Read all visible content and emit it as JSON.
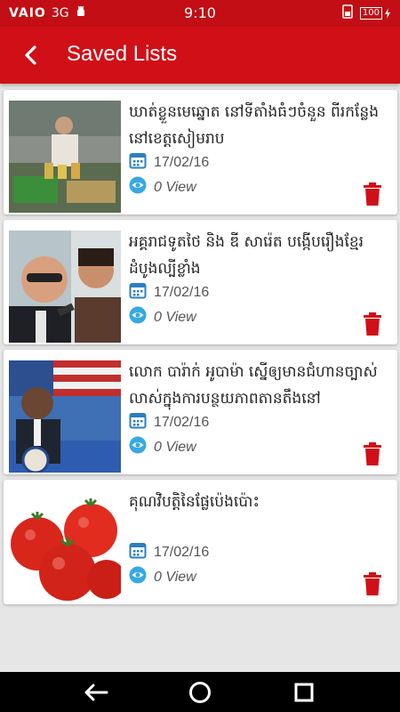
{
  "status_bar": {
    "brand": "VAIO",
    "network": "3G",
    "time": "9:10",
    "battery": "100"
  },
  "app_bar": {
    "title": "Saved Lists"
  },
  "items": [
    {
      "headline": "ឃាត់ខ្លួនមេឆ្នោត នៅទីតាំងធំៗចំនួន ពីរកន្លែង នៅខេត្តសៀមរាប",
      "date": "17/02/16",
      "views": "0 View"
    },
    {
      "headline": "អគ្គរាជទូតថៃ និង ឌី សារ៉េត បង្កើបរឿងខ្មែរដំបូងល្បីខ្លាំង",
      "date": "17/02/16",
      "views": "0 View"
    },
    {
      "headline": "លោក បារ៉ាក់ អូបាម៉ា ស្នើឲ្យមានជំហានច្បាស់លាស់ក្នុងការបន្ថយភាពតានតឹងនៅ",
      "date": "17/02/16",
      "views": "0 View"
    },
    {
      "headline": "គុណវិបត្តិនៃផ្លែប៉េងប៉ោះ",
      "date": "17/02/16",
      "views": "0 View"
    }
  ],
  "colors": {
    "primary": "#d10f17",
    "status": "#c20e14",
    "icon_blue": "#2a7fc1",
    "trash_red": "#d10f17"
  }
}
